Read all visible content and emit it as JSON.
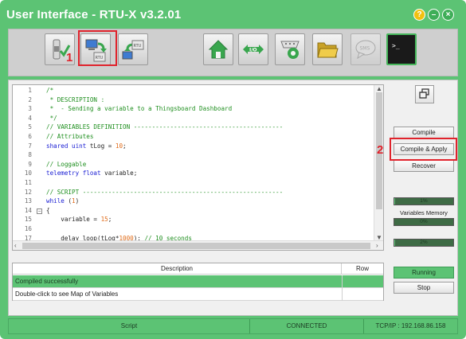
{
  "window": {
    "title": "User Interface - RTU-X v3.2.01",
    "help_label": "?",
    "minimize_label": "–",
    "close_label": "×"
  },
  "colors": {
    "accent": "#5cc374",
    "highlight": "#e0232c",
    "keyword": "#1c20d4",
    "comment": "#1f8f1f",
    "number": "#e06a17"
  },
  "toolbar": {
    "buttons": [
      {
        "name": "validate",
        "icon": "switch-check-icon",
        "enabled": true
      },
      {
        "name": "send-to-rtu",
        "icon": "computer-to-rtu-icon",
        "enabled": true
      },
      {
        "name": "receive-from-rtu",
        "icon": "rtu-to-computer-icon",
        "enabled": true
      },
      {
        "name": "home",
        "icon": "home-icon",
        "enabled": true
      },
      {
        "name": "io",
        "icon": "io-icon",
        "label": "I/O",
        "enabled": true
      },
      {
        "name": "serial-config",
        "icon": "serial-gear-icon",
        "enabled": true
      },
      {
        "name": "open-folder",
        "icon": "folder-icon",
        "enabled": true
      },
      {
        "name": "sms",
        "icon": "sms-icon",
        "label": "SMS",
        "enabled": false
      },
      {
        "name": "terminal",
        "icon": "terminal-icon",
        "label": ">_",
        "enabled": true
      }
    ]
  },
  "annotations": {
    "step1": "1",
    "step2": "2"
  },
  "editor": {
    "lines": [
      {
        "n": "1",
        "tokens": [
          [
            "c-comment",
            "/*"
          ]
        ]
      },
      {
        "n": "2",
        "tokens": [
          [
            "c-comment",
            " * DESCRIPTION :"
          ]
        ]
      },
      {
        "n": "3",
        "tokens": [
          [
            "c-comment",
            " *  - Sending a variable to a Thingsboard Dashboard"
          ]
        ]
      },
      {
        "n": "4",
        "tokens": [
          [
            "c-comment",
            " */"
          ]
        ]
      },
      {
        "n": "5",
        "tokens": [
          [
            "c-comment",
            "// VARIABLES DEFINITION -----------------------------------------"
          ]
        ]
      },
      {
        "n": "6",
        "tokens": [
          [
            "c-comment",
            "// Attributes"
          ]
        ]
      },
      {
        "n": "7",
        "tokens": [
          [
            "c-keyword",
            "shared uint "
          ],
          [
            "c-plain",
            "tLog = "
          ],
          [
            "c-number",
            "10"
          ],
          [
            "c-plain",
            ";"
          ]
        ]
      },
      {
        "n": "8",
        "tokens": []
      },
      {
        "n": "9",
        "tokens": [
          [
            "c-comment",
            "// Loggable"
          ]
        ]
      },
      {
        "n": "10",
        "tokens": [
          [
            "c-keyword",
            "telemetry float "
          ],
          [
            "c-plain",
            "variable;"
          ]
        ]
      },
      {
        "n": "11",
        "tokens": []
      },
      {
        "n": "12",
        "tokens": [
          [
            "c-comment",
            "// SCRIPT -------------------------------------------------------"
          ]
        ]
      },
      {
        "n": "13",
        "tokens": [
          [
            "c-keyword",
            "while "
          ],
          [
            "c-plain",
            "("
          ],
          [
            "c-number",
            "1"
          ],
          [
            "c-plain",
            ")"
          ]
        ]
      },
      {
        "n": "14",
        "fold": "−",
        "tokens": [
          [
            "c-plain",
            "{"
          ]
        ]
      },
      {
        "n": "15",
        "tokens": [
          [
            "c-plain",
            "    variable = "
          ],
          [
            "c-number",
            "15"
          ],
          [
            "c-plain",
            ";"
          ]
        ]
      },
      {
        "n": "16",
        "tokens": []
      },
      {
        "n": "17",
        "tokens": [
          [
            "c-plain",
            "    delay_loop(tLog*"
          ],
          [
            "c-number",
            "1000"
          ],
          [
            "c-plain",
            "); "
          ],
          [
            "c-comment",
            "// 10 seconds"
          ]
        ]
      }
    ]
  },
  "messages": {
    "header_description": "Description",
    "header_row": "Row",
    "rows": [
      {
        "text": "Compiled successfully",
        "row": "",
        "selected": true
      },
      {
        "text": "Double-click to see Map of Variables",
        "row": "",
        "selected": false
      }
    ]
  },
  "side": {
    "compile_label": "Compile",
    "compile_apply_label": "Compile & Apply",
    "recover_label": "Recover",
    "memory_label": "Variables Memory",
    "meters": [
      {
        "name": "memory-meter-1",
        "text": "1%",
        "value": 1
      },
      {
        "name": "memory-meter-2",
        "text": "0%",
        "value": 0
      },
      {
        "name": "memory-meter-3",
        "text": "2%",
        "value": 2
      }
    ],
    "running_label": "Running",
    "stop_label": "Stop"
  },
  "status": {
    "mode": "Script",
    "connection": "CONNECTED",
    "address": "TCP/IP : 192.168.86.158"
  }
}
